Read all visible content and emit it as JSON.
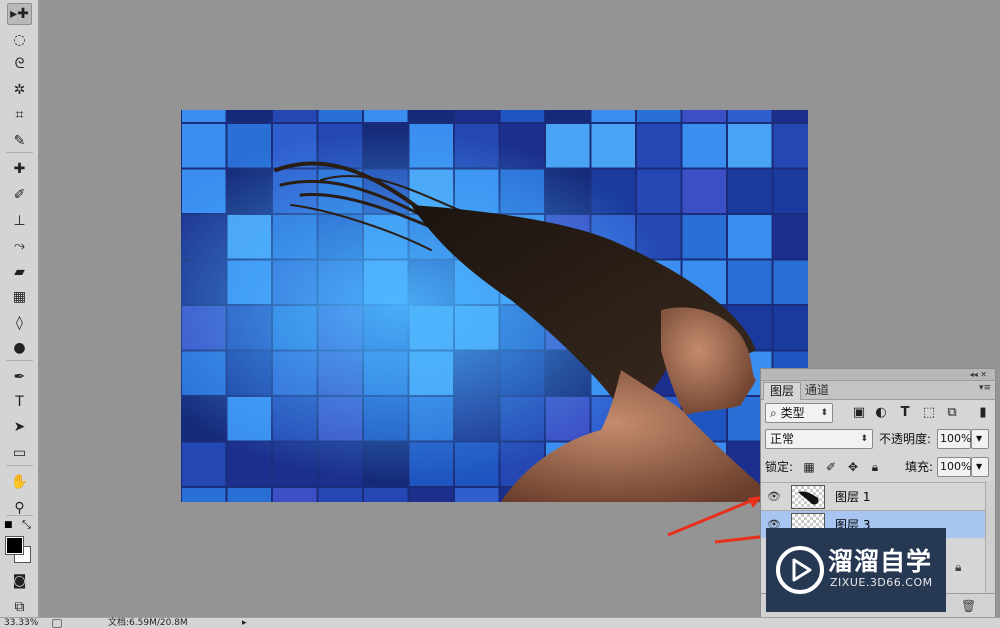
{
  "toolbar": {
    "tools": [
      {
        "name": "move-tool",
        "glyph": "▸✚"
      },
      {
        "name": "marquee-tool",
        "glyph": "◌"
      },
      {
        "name": "lasso-tool",
        "glyph": "ᘓ"
      },
      {
        "name": "quick-select-tool",
        "glyph": "✲"
      },
      {
        "name": "crop-tool",
        "glyph": "⌗"
      },
      {
        "name": "eyedropper-tool",
        "glyph": "✎"
      },
      {
        "name": "healing-brush-tool",
        "glyph": "✚"
      },
      {
        "name": "brush-tool",
        "glyph": "✐"
      },
      {
        "name": "clone-stamp-tool",
        "glyph": "⊥"
      },
      {
        "name": "history-brush-tool",
        "glyph": "⤳"
      },
      {
        "name": "eraser-tool",
        "glyph": "▰"
      },
      {
        "name": "gradient-tool",
        "glyph": "▦"
      },
      {
        "name": "blur-tool",
        "glyph": "◊"
      },
      {
        "name": "dodge-tool",
        "glyph": "●"
      },
      {
        "name": "pen-tool",
        "glyph": "✒"
      },
      {
        "name": "type-tool",
        "glyph": "T"
      },
      {
        "name": "path-select-tool",
        "glyph": "➤"
      },
      {
        "name": "rectangle-tool",
        "glyph": "▭"
      },
      {
        "name": "hand-tool",
        "glyph": "✋"
      },
      {
        "name": "zoom-tool",
        "glyph": "⚲"
      },
      {
        "name": "quick-mask-tool",
        "glyph": "◙"
      },
      {
        "name": "screen-mode-tool",
        "glyph": "⧉"
      }
    ]
  },
  "statusbar": {
    "zoom": "33.33%",
    "doc_label": "文档:6.59M/20.8M",
    "arrow": "▸"
  },
  "layers_panel": {
    "collapse_label": "◂◂ ✕",
    "tabs": [
      "图层",
      "通道"
    ],
    "filter_kind": "类型",
    "filter_icon": "⌕",
    "filter_caret": "⬍",
    "blend_mode": "正常",
    "opacity_label": "不透明度:",
    "opacity_value": "100%",
    "lock_label": "锁定:",
    "fill_label": "填充:",
    "fill_value": "100%",
    "layers": [
      {
        "name": "图层 1",
        "selected": false
      },
      {
        "name": "图层 3",
        "selected": true
      }
    ]
  },
  "watermark": {
    "title": "溜溜自学",
    "url": "ZIXUE.3D66.COM"
  },
  "colors": {
    "canvas_bg": "#949494",
    "toolbar_bg": "#d4d4d4",
    "selected_layer": "#a9c6f2",
    "arrow_red": "#e8301c",
    "watermark_bg": "#263852"
  }
}
